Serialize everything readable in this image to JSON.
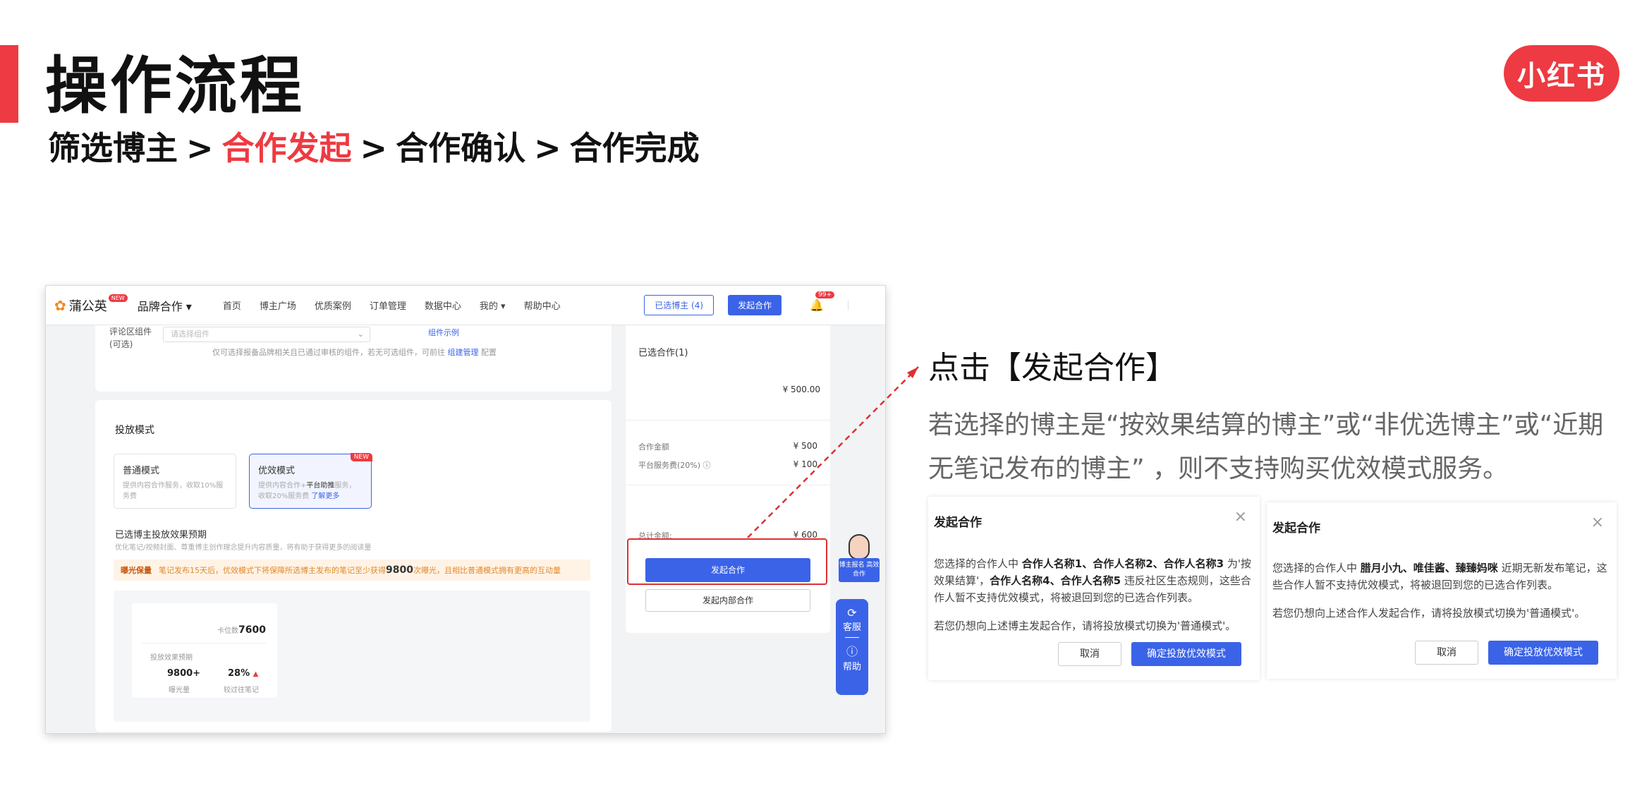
{
  "slide": {
    "title": "操作流程",
    "steps": [
      "筛选博主",
      ">",
      "合作发起",
      ">",
      "合作确认",
      ">",
      "合作完成"
    ],
    "logo_text": "小红书",
    "accent_color": "#ee3a42"
  },
  "app": {
    "nav": {
      "brand": "蒲公英",
      "brand_new": "NEW",
      "brand_coop": "品牌合作 ▾",
      "items": [
        "首页",
        "博主广场",
        "优质案例",
        "订单管理",
        "数据中心",
        "我的 ▾",
        "帮助中心"
      ],
      "selected_btn": "已选博主 (4)",
      "start_btn": "发起合作",
      "bell_badge": "99+",
      "primary_color": "#3b63e8"
    },
    "comment_card": {
      "label": "评论区组件(可选)",
      "select_placeholder": "请选择组件",
      "example_link": "组件示例",
      "hint_prefix": "仅可选择报备品牌相关且已通过审核的组件，若无可选组件，可前往",
      "hint_link": "组建管理",
      "hint_suffix": "配置"
    },
    "delivery": {
      "section_title": "投放模式",
      "mode_normal": {
        "name": "普通模式",
        "desc": "提供内容合作服务，收取10%服务费"
      },
      "mode_effect": {
        "name": "优效模式",
        "new_tag": "NEW",
        "desc_prefix": "提供内容合作+",
        "desc_strong": "平台助推",
        "desc_mid": "服务，收取20%服务费",
        "desc_link": "了解更多"
      },
      "predict_title": "已选博主投放效果预期",
      "predict_desc": "优化笔记/视频封面、尊重博主创作理念提升内容质量，将有助于获得更多的阅读量",
      "banner_tag": "曝光保量",
      "banner_text_1": "笔记发布15天后，优效模式下将保障所选博主发布的笔记至少获得",
      "banner_big": "9800",
      "banner_text_2": "次曝光，且相比普通模式拥有更高的互动量",
      "rank_label": "卡位数",
      "rank_value": "7600",
      "predict_subtitle": "投放效果预期",
      "exposure_value": "9800+",
      "exposure_label": "曝光量",
      "ratio_value": "28%",
      "ratio_up": "▲",
      "ratio_label": "较过往笔记"
    },
    "side": {
      "selected_title": "已选合作(1)",
      "selected_amount": "¥ 500.00",
      "coop_amount_label": "合作金额",
      "coop_amount": "¥ 500",
      "service_fee_label": "平台服务费(20%) ⓘ",
      "service_fee": "¥ 100",
      "total_label": "总计金额:",
      "total": "¥ 600",
      "start_btn": "发起合作",
      "inner_btn": "发起内部合作"
    },
    "mascot_label": "博主报名 高效合作",
    "help": {
      "service": "客服",
      "help": "帮助"
    }
  },
  "note": {
    "title": "点击【发起合作】",
    "body": "若选择的博主是“按效果结算的博主”或“非优选博主”或“近期无笔记发布的博主” ，则不支持购买优效模式服务。"
  },
  "dialog1": {
    "title": "发起合作",
    "p1_prefix": "您选择的合作人中 ",
    "p1_names_a": "合作人名称1、合作人名称2、合作人名称3",
    "p1_mid": " 为'按效果结算'，",
    "p1_names_b": "合作人名称4、合作人名称5",
    "p1_suffix": " 违反社区生态规则，这些合作人暂不支持优效模式，将被退回到您的已选合作列表。",
    "p2": "若您仍想向上述博主发起合作，请将投放模式切换为'普通模式'。",
    "cancel": "取消",
    "confirm": "确定投放优效模式"
  },
  "dialog2": {
    "title": "发起合作",
    "p1_prefix": "您选择的合作人中 ",
    "p1_names": "腊月小九、唯佳酱、臻臻妈咪",
    "p1_suffix": " 近期无新发布笔记，这些合作人暂不支持优效模式，将被退回到您的已选合作列表。",
    "p2": "若您仍想向上述合作人发起合作，请将投放模式切换为'普通模式'。",
    "cancel": "取消",
    "confirm": "确定投放优效模式"
  }
}
